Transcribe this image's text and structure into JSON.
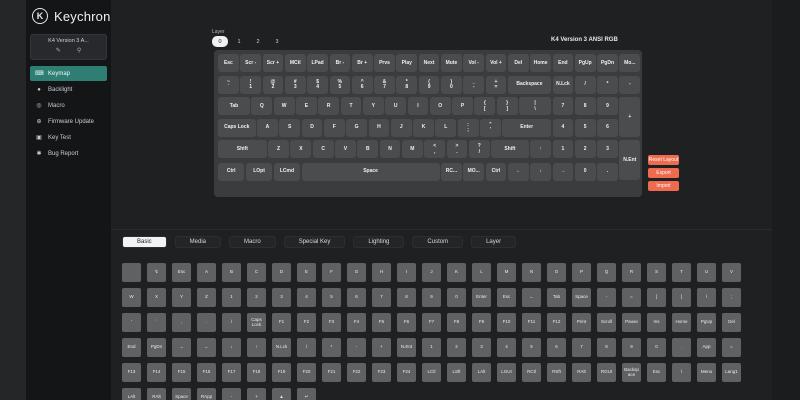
{
  "app": {
    "brand": "Keychron",
    "logo_letter": "K"
  },
  "device": {
    "name": "K4 Version 3 A..."
  },
  "nav": [
    {
      "label": "Keymap",
      "icon": "keyboard-icon",
      "glyph": "⌨",
      "active": true
    },
    {
      "label": "Backlight",
      "icon": "bulb-icon",
      "glyph": "●",
      "active": false
    },
    {
      "label": "Macro",
      "icon": "macro-icon",
      "glyph": "◎",
      "active": false
    },
    {
      "label": "Firmware Update",
      "icon": "update-icon",
      "glyph": "⊕",
      "active": false
    },
    {
      "label": "Key Test",
      "icon": "key-test-icon",
      "glyph": "▣",
      "active": false
    },
    {
      "label": "Bug Report",
      "icon": "bug-icon",
      "glyph": "✱",
      "active": false
    }
  ],
  "layer": {
    "label": "Layer",
    "tabs": [
      "0",
      "1",
      "2",
      "3"
    ],
    "active": "0"
  },
  "keyboard_title": "K4 Version 3 ANSI RGB",
  "side_buttons": [
    "Reset Layout",
    "Export",
    "Import"
  ],
  "keyboard_rows": [
    [
      "Esc",
      "Scr -",
      "Scr +",
      "MCtl",
      "LPad",
      "Br -",
      "Br +",
      "Prvs",
      "Play",
      "Next",
      "Mute",
      "Vol -",
      "Vol +",
      "Del",
      "Home",
      "End",
      "PgUp",
      "PgDn",
      "Mo..."
    ],
    [
      "~\n`",
      "!\n1",
      "@\n2",
      "#\n3",
      "$\n4",
      "%\n5",
      "^\n6",
      "&\n7",
      "*\n8",
      "(\n9",
      ")\n0",
      "_\n-",
      "+\n=",
      "Backspace",
      "N.Lck",
      "/",
      "*",
      "-"
    ],
    [
      "Tab",
      "Q",
      "W",
      "E",
      "R",
      "T",
      "Y",
      "U",
      "I",
      "O",
      "P",
      "{\n[",
      "}\n]",
      "|\n\\",
      "7",
      "8",
      "9",
      "+"
    ],
    [
      "Caps Lock",
      "A",
      "S",
      "D",
      "F",
      "G",
      "H",
      "J",
      "K",
      "L",
      ":\n;",
      "\"\n'",
      "Enter",
      "4",
      "5",
      "6"
    ],
    [
      "Shift",
      "Z",
      "X",
      "C",
      "V",
      "B",
      "N",
      "M",
      "<\n,",
      ">\n.",
      "?\n/",
      "Shift",
      "↑",
      "1",
      "2",
      "3",
      "N.Ent"
    ],
    [
      "Ctrl",
      "LOpt",
      "LCmd",
      "Space",
      "RC...",
      "MO...",
      "Ctrl",
      "←",
      "↓",
      "→",
      "0",
      "."
    ]
  ],
  "categories": [
    "Basic",
    "Media",
    "Macro",
    "Special Key",
    "Lighting",
    "Custom",
    "Layer"
  ],
  "active_category": "Basic",
  "keycode_rows": [
    [
      "",
      "↯",
      "Esc",
      "A",
      "B",
      "C",
      "D",
      "E",
      "F",
      "G",
      "H",
      "I",
      "J",
      "K",
      "L",
      "M",
      "N",
      "O",
      "P",
      "Q",
      "R",
      "S",
      "T",
      "U",
      "V"
    ],
    [
      "W",
      "X",
      "Y",
      "Z",
      "1",
      "2",
      "3",
      "4",
      "5",
      "6",
      "7",
      "8",
      "9",
      "0",
      "Enter",
      "Esc",
      "←",
      "Tab",
      "Space",
      "-",
      "=",
      "[",
      "]",
      "\\",
      ";"
    ],
    [
      "'",
      "`",
      ",",
      ".",
      "/",
      "Caps\nLock",
      "F1",
      "F2",
      "F3",
      "F4",
      "F5",
      "F6",
      "F7",
      "F8",
      "F9",
      "F10",
      "F11",
      "F12",
      "Print",
      "Scroll",
      "Pause",
      "Ins",
      "Home",
      "PgUp",
      "Del"
    ],
    [
      "End",
      "PgDn",
      "→",
      "←",
      "↓",
      "↑",
      "N.Lck",
      "/",
      "*",
      "-",
      "+",
      "N.Ent",
      "1",
      "2",
      "3",
      "4",
      "5",
      "6",
      "7",
      "8",
      "9",
      "0",
      ".",
      "App",
      "="
    ],
    [
      "F13",
      "F14",
      "F15",
      "F16",
      "F17",
      "F18",
      "F19",
      "F20",
      "F21",
      "F22",
      "F23",
      "F24",
      "LCtl",
      "LSft",
      "LAlt",
      "LGUI",
      "RCtl",
      "RSft",
      "RAlt",
      "RGUI",
      "Backsp\nace",
      "Esc",
      "\\",
      "Menu",
      "Lang1"
    ],
    [
      "LAlt",
      "RAlt",
      "Space",
      "RApp",
      "-",
      "+",
      "▲",
      "↵"
    ]
  ],
  "colors": {
    "accent": "#2f7e73",
    "button_orange": "#ee6b4f",
    "key": "#4a4c4e",
    "keycode": "#5f6163"
  }
}
